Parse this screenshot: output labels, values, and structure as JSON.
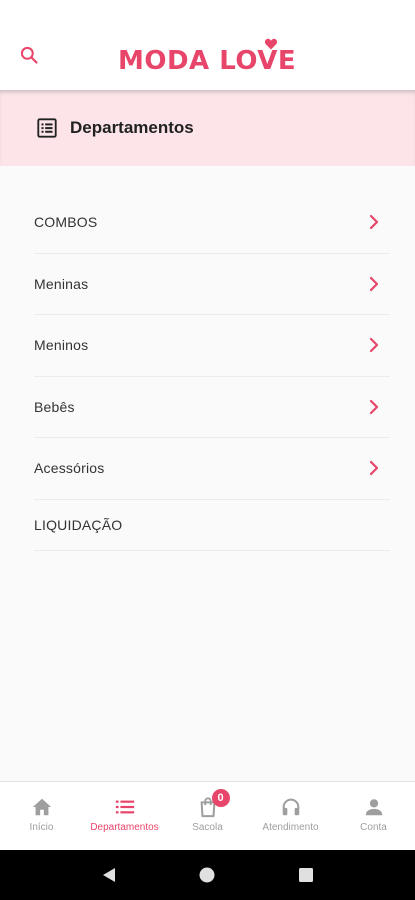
{
  "header": {
    "brand_part1": "MODA ",
    "brand_part2": "LOVE",
    "search_icon": "search-icon",
    "accent_color": "#e8456b"
  },
  "section": {
    "icon": "list-alt-icon",
    "title": "Departamentos",
    "background": "#fce4e8"
  },
  "categories": [
    {
      "label": "COMBOS",
      "has_chevron": true
    },
    {
      "label": "Meninas",
      "has_chevron": true
    },
    {
      "label": "Meninos",
      "has_chevron": true
    },
    {
      "label": "Bebês",
      "has_chevron": true
    },
    {
      "label": "Acessórios",
      "has_chevron": true
    },
    {
      "label": "LIQUIDAÇÃO",
      "has_chevron": false
    }
  ],
  "bottom_nav": {
    "items": [
      {
        "label": "Início",
        "icon": "home-icon",
        "active": false
      },
      {
        "label": "Departamentos",
        "icon": "list-icon",
        "active": true
      },
      {
        "label": "Sacola",
        "icon": "shopping-bag-icon",
        "active": false,
        "badge": "0"
      },
      {
        "label": "Atendimento",
        "icon": "headset-icon",
        "active": false
      },
      {
        "label": "Conta",
        "icon": "person-icon",
        "active": false
      }
    ]
  },
  "system_nav": {
    "back": "back-icon",
    "home": "home-circle-icon",
    "recents": "recents-icon"
  }
}
